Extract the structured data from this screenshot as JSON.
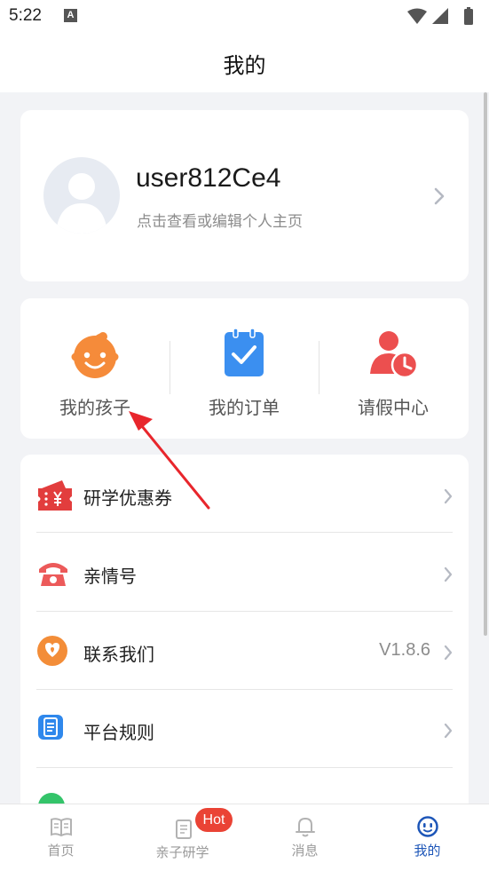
{
  "status_bar": {
    "time": "5:22",
    "notification_icon": "A"
  },
  "header": {
    "title": "我的"
  },
  "profile": {
    "username": "user812Ce4",
    "subtitle": "点击查看或编辑个人主页"
  },
  "quick_actions": [
    {
      "label": "我的孩子",
      "icon": "baby-face-icon"
    },
    {
      "label": "我的订单",
      "icon": "clipboard-check-icon"
    },
    {
      "label": "请假中心",
      "icon": "person-clock-icon"
    }
  ],
  "menu": [
    {
      "label": "研学优惠券",
      "icon": "coupon-icon",
      "value": ""
    },
    {
      "label": "亲情号",
      "icon": "telephone-icon",
      "value": ""
    },
    {
      "label": "联系我们",
      "icon": "heart-chat-icon",
      "value": "V1.8.6"
    },
    {
      "label": "平台规则",
      "icon": "document-list-icon",
      "value": ""
    }
  ],
  "tabbar": {
    "items": [
      {
        "label": "首页",
        "icon": "open-book-icon"
      },
      {
        "label": "亲子研学",
        "icon": "notebook-icon"
      },
      {
        "label": "消息",
        "icon": "bell-icon"
      },
      {
        "label": "我的",
        "icon": "smiley-face-icon"
      }
    ],
    "badge": "Hot",
    "active_index": 3
  },
  "colors": {
    "active_tab": "#1d56b8",
    "badge": "#ea4335",
    "annotation_arrow": "#e8262c"
  }
}
